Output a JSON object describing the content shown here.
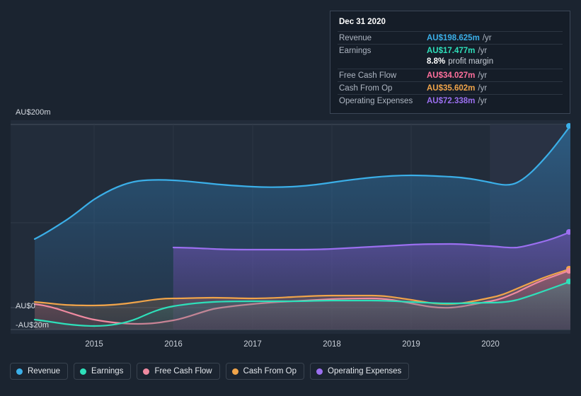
{
  "tooltip": {
    "date": "Dec 31 2020",
    "rows": [
      {
        "label": "Revenue",
        "value": "AU$198.625m",
        "unit": "/yr",
        "color": "#3bafe8"
      },
      {
        "label": "Earnings",
        "value": "AU$17.477m",
        "unit": "/yr",
        "color": "#2ee0ba"
      },
      {
        "label": "",
        "value": "8.8%",
        "unit": "",
        "margin_label": "profit margin",
        "color": "#ffffff"
      },
      {
        "label": "Free Cash Flow",
        "value": "AU$34.027m",
        "unit": "/yr",
        "color": "#ff6f9c"
      },
      {
        "label": "Cash From Op",
        "value": "AU$35.602m",
        "unit": "/yr",
        "color": "#f0a44a"
      },
      {
        "label": "Operating Expenses",
        "value": "AU$72.338m",
        "unit": "/yr",
        "color": "#9b6ff0"
      }
    ]
  },
  "axis": {
    "y_top_label": "AU$200m",
    "y_zero_label": "AU$0",
    "y_neg_label": "-AU$20m",
    "x_labels": [
      "2015",
      "2016",
      "2017",
      "2018",
      "2019",
      "2020"
    ]
  },
  "legend": [
    {
      "label": "Revenue",
      "color": "#3bafe8"
    },
    {
      "label": "Earnings",
      "color": "#2ee0ba"
    },
    {
      "label": "Free Cash Flow",
      "color": "#ff6f9c"
    },
    {
      "label": "Cash From Op",
      "color": "#f0a44a"
    },
    {
      "label": "Operating Expenses",
      "color": "#9b6ff0"
    }
  ],
  "chart_data": {
    "type": "area",
    "title": "",
    "xlabel": "",
    "ylabel": "AU$",
    "ylim": [
      -20,
      200
    ],
    "yticks": [
      -20,
      0,
      200
    ],
    "grid": true,
    "x": [
      2014.3,
      2014.6,
      2015.0,
      2015.3,
      2015.6,
      2016.0,
      2016.3,
      2016.6,
      2017.0,
      2017.3,
      2017.6,
      2018.0,
      2018.3,
      2018.6,
      2019.0,
      2019.3,
      2019.6,
      2020.0,
      2020.3,
      2020.6,
      2020.95
    ],
    "x_tick_values": [
      2015,
      2016,
      2017,
      2018,
      2019,
      2020
    ],
    "series": [
      {
        "name": "Revenue",
        "color": "#3bafe8",
        "values": [
          88,
          96,
          108,
          118,
          126,
          131,
          130,
          129,
          127,
          126,
          127,
          128,
          130,
          134,
          138,
          140,
          141,
          140,
          133,
          150,
          198.625
        ]
      },
      {
        "name": "Operating Expenses",
        "color": "#9b6ff0",
        "values": [
          null,
          null,
          null,
          null,
          null,
          62,
          61,
          60,
          60,
          60,
          60,
          60,
          60,
          61,
          62,
          63,
          64,
          65,
          64,
          67,
          72.338
        ]
      },
      {
        "name": "Cash From Op",
        "color": "#f0a44a",
        "values": [
          6,
          5,
          3,
          2,
          2,
          1,
          3,
          7,
          8,
          8,
          8,
          9,
          10,
          11,
          11,
          8,
          3,
          5,
          11,
          22,
          35.602
        ]
      },
      {
        "name": "Free Cash Flow",
        "color": "#ff6f9c",
        "values": [
          4,
          2,
          -3,
          -8,
          -10,
          -11,
          -6,
          2,
          5,
          6,
          6,
          7,
          8,
          9,
          9,
          6,
          1,
          3,
          9,
          20,
          34.027
        ]
      },
      {
        "name": "Earnings",
        "color": "#2ee0ba",
        "values": [
          -14,
          -15,
          -16,
          -16,
          -13,
          -6,
          -1,
          2,
          3,
          3,
          3,
          3,
          3,
          4,
          4,
          4,
          3,
          3,
          3,
          8,
          17.477
        ]
      }
    ]
  }
}
